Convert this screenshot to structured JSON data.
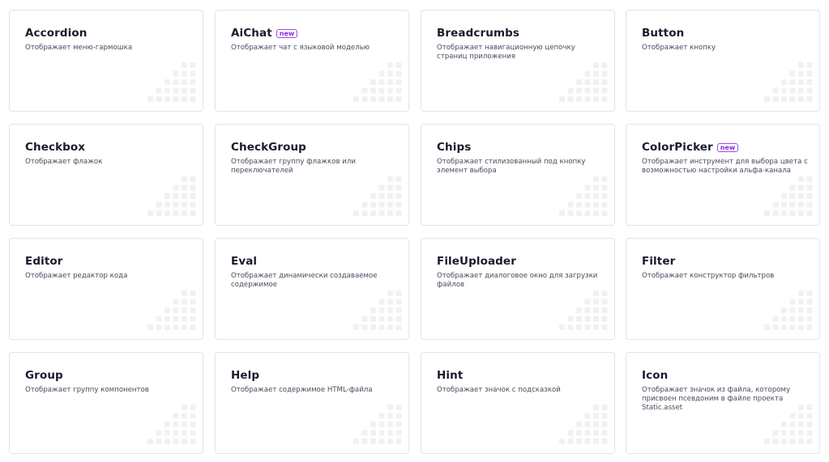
{
  "cards": [
    {
      "title": "Accordion",
      "badge": "",
      "desc": "Отображает меню-гармошка"
    },
    {
      "title": "AiChat",
      "badge": "new",
      "desc": "Отображает чат с языковой моделью"
    },
    {
      "title": "Breadcrumbs",
      "badge": "",
      "desc": "Отображает навигационную цепочку страниц приложения"
    },
    {
      "title": "Button",
      "badge": "",
      "desc": "Отображает кнопку"
    },
    {
      "title": "Checkbox",
      "badge": "",
      "desc": "Отображает флажок"
    },
    {
      "title": "CheckGroup",
      "badge": "",
      "desc": "Отображает группу флажков или переключателей"
    },
    {
      "title": "Chips",
      "badge": "",
      "desc": "Отображает стилизованный под кнопку элемент выбора"
    },
    {
      "title": "ColorPicker",
      "badge": "new",
      "desc": "Отображает инструмент для выбора цвета с возможностью настройки альфа-канала"
    },
    {
      "title": "Editor",
      "badge": "",
      "desc": "Отображает редактор кода"
    },
    {
      "title": "Eval",
      "badge": "",
      "desc": "Отображает динамически создаваемое содержимое"
    },
    {
      "title": "FileUploader",
      "badge": "",
      "desc": "Отображает диалоговое окно для загрузки файлов"
    },
    {
      "title": "Filter",
      "badge": "",
      "desc": "Отображает конструктор фильтров"
    },
    {
      "title": "Group",
      "badge": "",
      "desc": "Отображает группу компонентов"
    },
    {
      "title": "Help",
      "badge": "",
      "desc": "Отображает содержимое HTML-файла"
    },
    {
      "title": "Hint",
      "badge": "",
      "desc": "Отображает значок с подсказкой"
    },
    {
      "title": "Icon",
      "badge": "",
      "desc": "Отображает значок из файла, которому присвоен псевдоним в файле проекта Static.asset"
    }
  ],
  "colors": {
    "badge": "#8a2be2",
    "card_border": "#e3e3ea",
    "dot": "#f1f1f5"
  }
}
